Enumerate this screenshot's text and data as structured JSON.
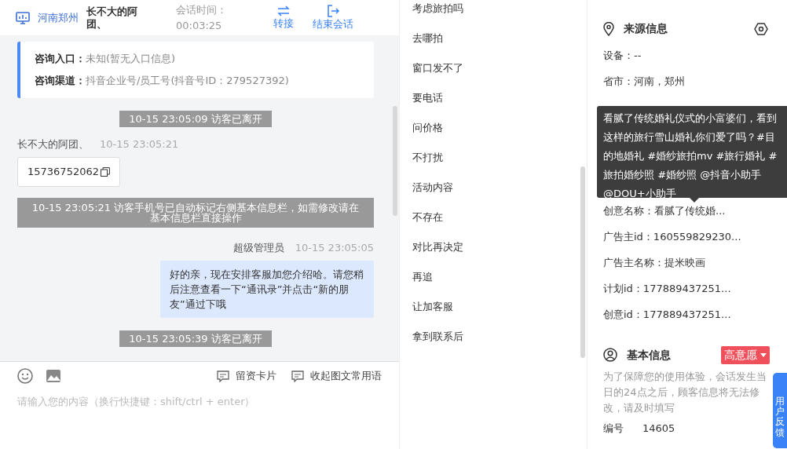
{
  "header": {
    "location": "河南郑州",
    "visitor_name": "长不大的阿团、",
    "session_time_label": "会话时间：",
    "session_time": "00:03:25",
    "actions": [
      {
        "label": "转接",
        "kind": "transfer"
      },
      {
        "label": "结束会话",
        "kind": "end"
      }
    ]
  },
  "consult_info": [
    {
      "label": "咨询入口：",
      "value": "未知(暂无入口信息)"
    },
    {
      "label": "咨询渠道：",
      "value": "抖音企业号/员工号(抖音号ID：279527392)"
    }
  ],
  "messages": [
    {
      "kind": "system",
      "text": "10-15 23:05:09 访客已离开"
    },
    {
      "kind": "visitor",
      "sender": "长不大的阿团、",
      "time": "10-15 23:05:21",
      "text": "15736752062"
    },
    {
      "kind": "system",
      "text": "10-15 23:05:21 访客手机号已自动标记右侧基本信息栏，如需修改请在基本信息栏直接操作"
    },
    {
      "kind": "agent",
      "sender": "超级管理员",
      "time": "10-15 23:05:05",
      "text": "好的亲，现在安排客服加您介绍哈。请您稍后注意查看一下“通讯录”并点击“新的朋友”通过下哦"
    },
    {
      "kind": "system",
      "text": "10-15 23:05:39 访客已离开"
    }
  ],
  "composer": {
    "tools": [
      {
        "kind": "emoji"
      },
      {
        "kind": "image"
      }
    ],
    "actions": [
      "留资卡片",
      "收起图文常用语"
    ],
    "placeholder": "请输入您的内容（换行快捷键：shift/ctrl + enter）"
  },
  "quick_replies": [
    "考虑旅拍吗",
    "去哪拍",
    "窗口发不了",
    "要电话",
    "问价格",
    "不打扰",
    "活动内容",
    "不存在",
    "对比再决定",
    "再追",
    "让加客服",
    "拿到联系后"
  ],
  "source_info": {
    "title": "来源信息",
    "rows_above": [
      "设备：--",
      "省市：河南，郑州"
    ],
    "tooltip": "看腻了传统婚礼仪式的小富婆们，看到这样的旅行雪山婚礼你们爱了吗？#目的地婚礼 #婚纱旅拍mv #旅行婚礼 #旅拍婚纱照 #婚纱照 @抖音小助手 @DOU+小助手",
    "rows_below": [
      "创意名称：看腻了传统婚...",
      "广告主id：160559829230...",
      "广告主名称：提米映画",
      "计划id：177889437251...",
      "创意id：177889437251..."
    ]
  },
  "basic_info": {
    "title": "基本信息",
    "intent_tag": "高意愿",
    "notice": "为了保障您的使用体验，会话发生当日的24点之后，顾客信息将无法修改，请及时填写",
    "fields": [
      {
        "label": "编号",
        "value": "14605"
      }
    ]
  },
  "feedback_tab": {
    "label": "用户反馈"
  }
}
